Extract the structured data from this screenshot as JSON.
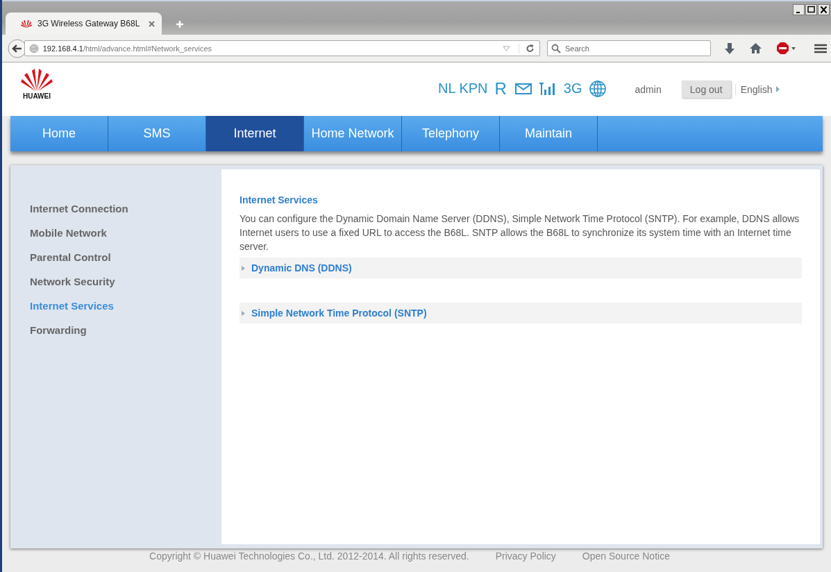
{
  "browser": {
    "tab": {
      "title": "3G Wireless Gateway B68L",
      "selected": true
    },
    "url": {
      "host": "192.168.4.1",
      "path": "/html/advance.html#Network_services"
    },
    "search": {
      "placeholder": "Search"
    }
  },
  "header": {
    "logo_text": "HUAWEI",
    "operator": "NL KPN",
    "roaming": "R",
    "network_type": "3G",
    "user": "admin",
    "logout": "Log out",
    "language": "English"
  },
  "nav": [
    {
      "label": "Home",
      "selected": false
    },
    {
      "label": "SMS",
      "selected": false
    },
    {
      "label": "Internet",
      "selected": true
    },
    {
      "label": "Home Network",
      "selected": false
    },
    {
      "label": "Telephony",
      "selected": false
    },
    {
      "label": "Maintain",
      "selected": false
    }
  ],
  "sidebar": {
    "items": [
      {
        "label": "Internet Connection",
        "selected": false
      },
      {
        "label": "Mobile Network",
        "selected": false
      },
      {
        "label": "Parental Control",
        "selected": false
      },
      {
        "label": "Network Security",
        "selected": false
      },
      {
        "label": "Internet Services",
        "selected": true
      },
      {
        "label": "Forwarding",
        "selected": false
      }
    ]
  },
  "content": {
    "title": "Internet Services",
    "description": "You can configure the Dynamic Domain Name Server (DDNS), Simple Network Time Protocol (SNTP). For example, DDNS allows Internet users to use a fixed URL to access the B68L. SNTP allows the B68L to synchronize its system time with an Internet time server.",
    "sections": [
      {
        "label": "Dynamic DNS (DDNS)",
        "expanded": false
      },
      {
        "label": "Simple Network Time Protocol (SNTP)",
        "expanded": false
      }
    ]
  },
  "footer": {
    "copyright": "Copyright © Huawei Technologies Co., Ltd. 2012-2014. All rights reserved.",
    "links": [
      "Privacy Policy",
      "Open Source Notice"
    ]
  }
}
